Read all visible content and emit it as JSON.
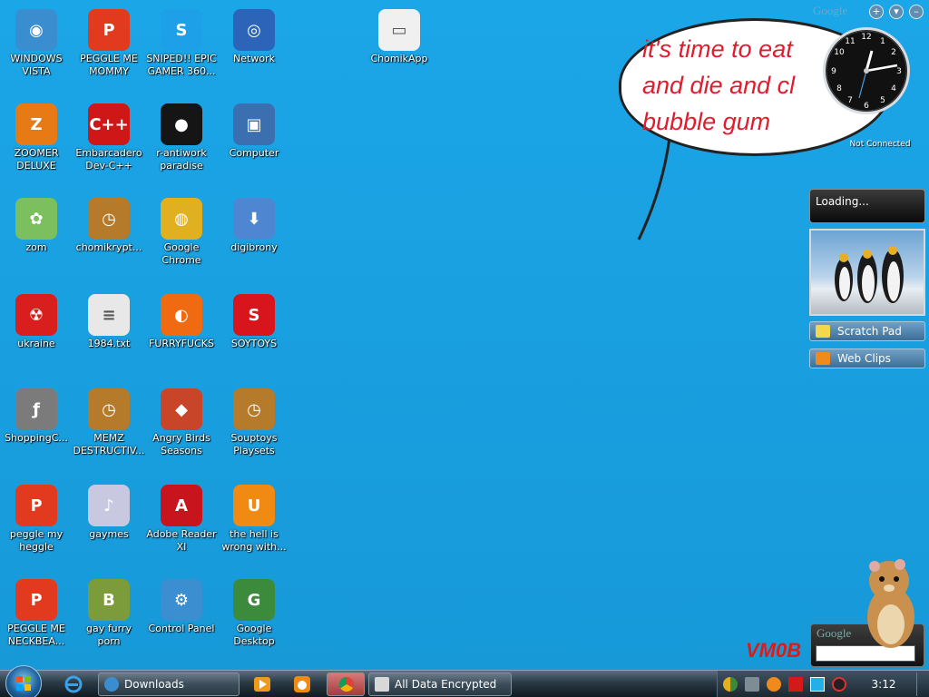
{
  "bubble": {
    "text": "it's time to eat\nand die and cl\nbubble gum"
  },
  "icons": [
    {
      "label": "WINDOWS\nVISTA",
      "icon": "windows-vista-orb-icon",
      "color": "#3a8ed0"
    },
    {
      "label": "PEGGLE ME\nMOMMY",
      "icon": "peggle-icon",
      "color": "#e23a1e"
    },
    {
      "label": "SNIPED!! EPIC\nGAMER 360...",
      "icon": "skype-icon",
      "color": "#1ea0e8"
    },
    {
      "label": "Network",
      "icon": "network-globe-icon",
      "color": "#2b64b8"
    },
    {
      "label": "ChomikApp",
      "icon": "app-window-icon",
      "color": "#f0f0f0"
    },
    {
      "label": "ZOOMER\nDELUXE",
      "icon": "zoomer-icon",
      "color": "#e87a16"
    },
    {
      "label": "Embarcadero\nDev-C++",
      "icon": "dev-cpp-icon",
      "color": "#cf1717"
    },
    {
      "label": "r-antiwork\nparadise",
      "icon": "dark-circle-icon",
      "color": "#151515"
    },
    {
      "label": "Computer",
      "icon": "computer-icon",
      "color": "#3b6fb0"
    },
    {
      "label": "zom",
      "icon": "flower-icon",
      "color": "#7bbf5e"
    },
    {
      "label": "chomikrypt...",
      "icon": "clock-file-icon",
      "color": "#b57a2a"
    },
    {
      "label": "Google\nChrome",
      "icon": "chrome-icon",
      "color": "#e0b020"
    },
    {
      "label": "digibrony",
      "icon": "installer-icon",
      "color": "#4e86d1"
    },
    {
      "label": "ukraine",
      "icon": "radiation-icon",
      "color": "#d91e1e"
    },
    {
      "label": "1984.txt",
      "icon": "text-file-icon",
      "color": "#e8e8e8"
    },
    {
      "label": "FURRYFUCKS",
      "icon": "firefox-icon",
      "color": "#f06a12"
    },
    {
      "label": "SOYTOYS",
      "icon": "red-s-icon",
      "color": "#d8141c"
    },
    {
      "label": "ShoppingC...",
      "icon": "flash-icon",
      "color": "#7b7b7b"
    },
    {
      "label": "MEMZ\nDESTRUCTIV...",
      "icon": "clock-file-icon",
      "color": "#b57a2a"
    },
    {
      "label": "Angry Birds\nSeasons",
      "icon": "angry-birds-icon",
      "color": "#c9452a"
    },
    {
      "label": "Souptoys\nPlaysets",
      "icon": "clock-file-icon",
      "color": "#b57a2a"
    },
    {
      "label": "peggle my\nheggle",
      "icon": "peggle-icon",
      "color": "#e23a1e"
    },
    {
      "label": "gaymes",
      "icon": "media-file-icon",
      "color": "#c8c8e0"
    },
    {
      "label": "Adobe Reader\nXI",
      "icon": "adobe-reader-icon",
      "color": "#c8141c"
    },
    {
      "label": "the hell is\nwrong with...",
      "icon": "uc-browser-icon",
      "color": "#f08a12"
    },
    {
      "label": "PEGGLE ME\nNECKBEA...",
      "icon": "peggle-icon",
      "color": "#e23a1e"
    },
    {
      "label": "gay furry\nporn",
      "icon": "beaver-box-icon",
      "color": "#7c9b3a"
    },
    {
      "label": "Control Panel",
      "icon": "control-panel-icon",
      "color": "#3b8fd0"
    },
    {
      "label": "Google\nDesktop",
      "icon": "google-desktop-icon",
      "color": "#3c8a3c"
    }
  ],
  "gadgets": {
    "google_logo": "Google",
    "add_button": "+",
    "menu_button": "▾",
    "minimize_button": "–",
    "clock_status": "Not Connected",
    "loading_text": "Loading...",
    "scratch_pad": "Scratch Pad",
    "web_clips": "Web Clips",
    "search_logo": "Google",
    "watermark": "VM0B"
  },
  "taskbar": {
    "downloads_label": "Downloads",
    "encrypted_label": "All Data Encrypted",
    "time": "3:12 PM"
  }
}
